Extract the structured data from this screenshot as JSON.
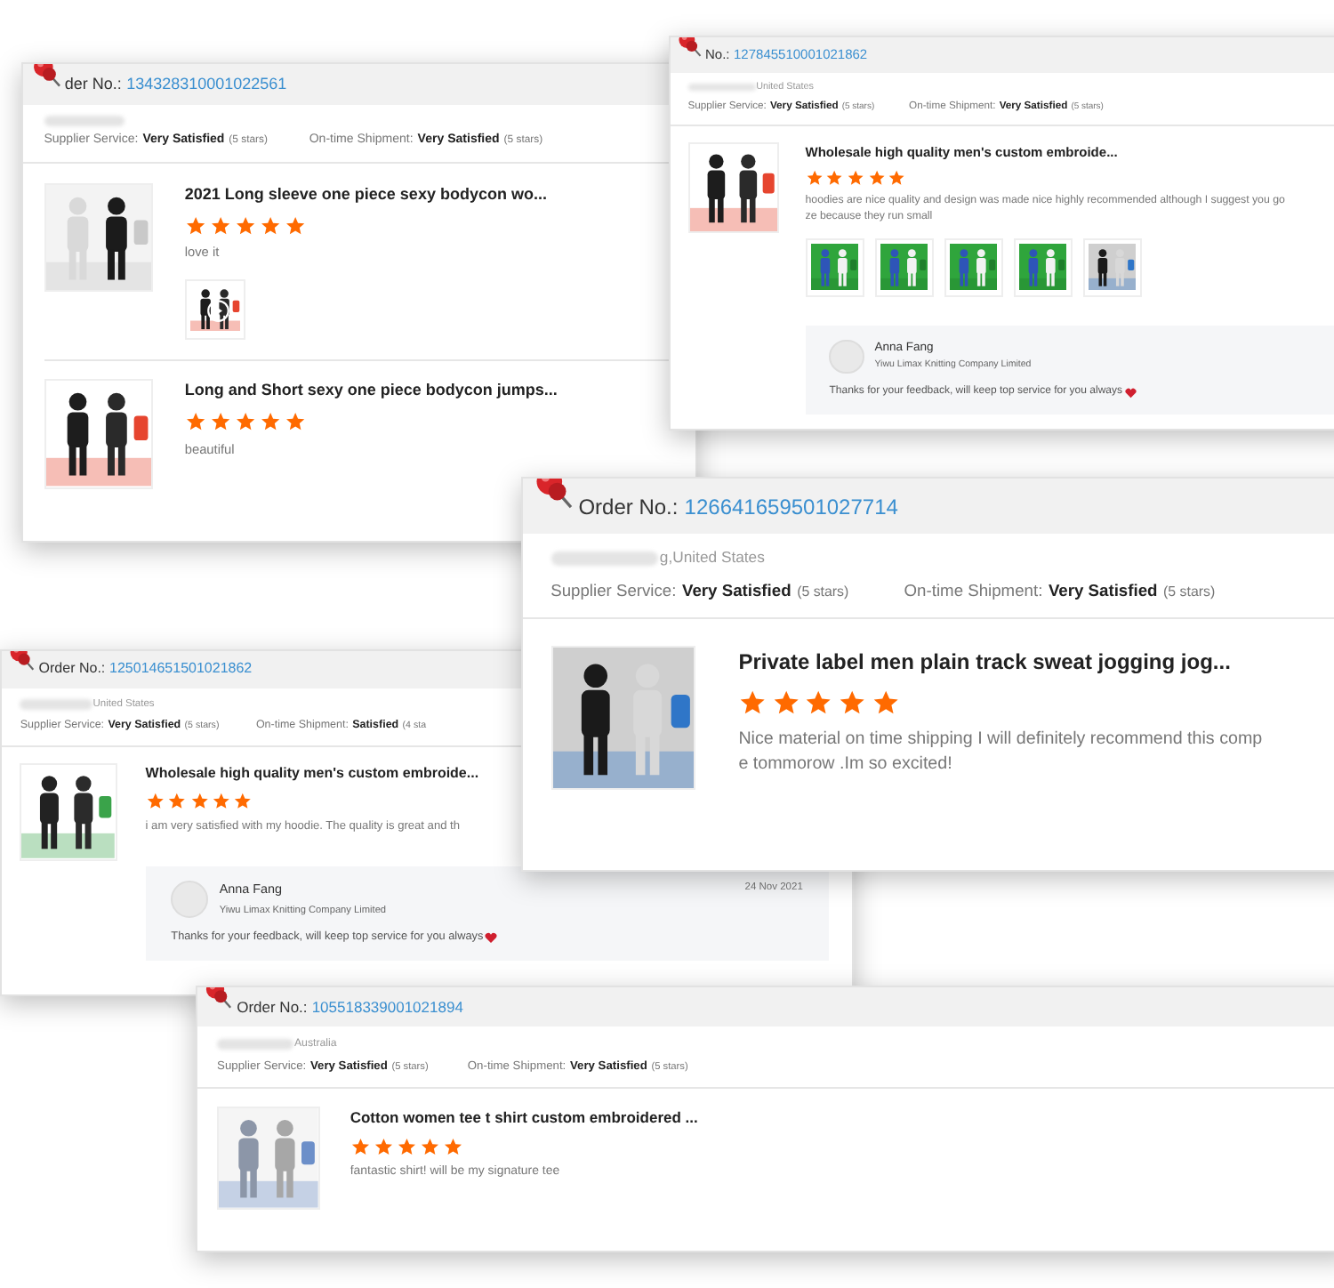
{
  "cards": [
    {
      "order_label": "der No.:",
      "order_number": "134328310001022561",
      "supplier_label": "Supplier Service:",
      "supplier_value": "Very Satisfied",
      "supplier_stars": "(5 stars)",
      "shipment_label": "On-time Shipment:",
      "shipment_value": "Very Satisfied",
      "shipment_stars": "(5 stars)",
      "products": [
        {
          "title": "2021 Long sleeve one piece sexy bodycon wo...",
          "stars": 5,
          "review": [
            "love it"
          ],
          "media": [
            {
              "kind": "video"
            }
          ]
        },
        {
          "title": "Long and Short sexy one piece bodycon jumps...",
          "stars": 5,
          "review": [
            "beautiful"
          ]
        }
      ]
    },
    {
      "order_label": "No.:",
      "order_number": "127845510001021862",
      "location": "United States",
      "supplier_label": "Supplier Service:",
      "supplier_value": "Very Satisfied",
      "supplier_stars": "(5 stars)",
      "shipment_label": "On-time Shipment:",
      "shipment_value": "Very Satisfied",
      "shipment_stars": "(5 stars)",
      "products": [
        {
          "title": "Wholesale high quality men's custom embroide...",
          "stars": 5,
          "review": [
            "hoodies are nice quality and design was made nice highly recommended although I suggest you go",
            "ze because they run small"
          ],
          "media": [
            {
              "kind": "picture"
            },
            {
              "kind": "picture"
            },
            {
              "kind": "picture"
            },
            {
              "kind": "picture"
            },
            {
              "kind": "picture"
            }
          ],
          "reply": {
            "name": "Anna Fang",
            "company": "Yiwu Limax Knitting Company Limited",
            "text": "Thanks for your feedback, will keep top service for you always"
          }
        }
      ]
    },
    {
      "order_label": "Order No.:",
      "order_number": "126641659501027714",
      "location": "g,United States",
      "supplier_label": "Supplier Service:",
      "supplier_value": "Very Satisfied",
      "supplier_stars": "(5 stars)",
      "shipment_label": "On-time Shipment:",
      "shipment_value": "Very Satisfied",
      "shipment_stars": "(5 stars)",
      "products": [
        {
          "title": "Private label men plain track sweat jogging jog...",
          "stars": 5,
          "review": [
            "Nice material on time shipping I will definitely recommend this comp",
            "e tommorow .Im so excited!"
          ]
        }
      ]
    },
    {
      "order_label": "Order No.:",
      "order_number": "125014651501021862",
      "location": "United States",
      "supplier_label": "Supplier Service:",
      "supplier_value": "Very Satisfied",
      "supplier_stars": "(5 stars)",
      "shipment_label": "On-time Shipment:",
      "shipment_value": "Satisfied",
      "shipment_stars": "(4 sta",
      "products": [
        {
          "title": "Wholesale high quality men's custom embroide...",
          "stars": 5,
          "review": [
            "i am very satisfied with my hoodie. The quality is great and th"
          ],
          "reply": {
            "name": "Anna Fang",
            "company": "Yiwu Limax Knitting Company Limited",
            "text": "Thanks for your feedback, will keep top service for you always",
            "date": "24 Nov 2021"
          }
        }
      ]
    },
    {
      "order_label": "Order No.:",
      "order_number": "105518339001021894",
      "location": "Australia",
      "supplier_label": "Supplier Service:",
      "supplier_value": "Very Satisfied",
      "supplier_stars": "(5 stars)",
      "shipment_label": "On-time Shipment:",
      "shipment_value": "Very Satisfied",
      "shipment_stars": "(5 stars)",
      "products": [
        {
          "title": "Cotton women tee t shirt custom embroidered ...",
          "stars": 5,
          "review": [
            "fantastic shirt! will be my signature tee"
          ]
        }
      ]
    }
  ]
}
